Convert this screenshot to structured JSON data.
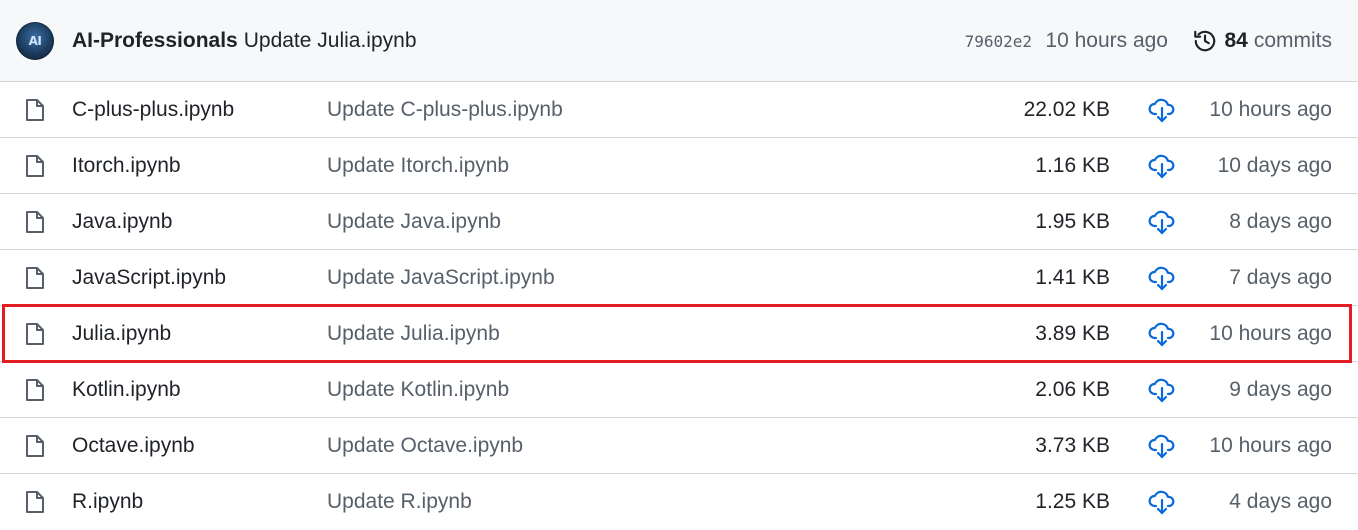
{
  "header": {
    "avatar_text": "AI",
    "author": "AI-Professionals",
    "message": "Update Julia.ipynb",
    "hash": "79602e2",
    "time": "10 hours ago",
    "commit_count": "84",
    "commit_label": "commits"
  },
  "files": [
    {
      "name": "C-plus-plus.ipynb",
      "message": "Update C-plus-plus.ipynb",
      "size": "22.02 KB",
      "time": "10 hours ago",
      "highlighted": false
    },
    {
      "name": "Itorch.ipynb",
      "message": "Update Itorch.ipynb",
      "size": "1.16 KB",
      "time": "10 days ago",
      "highlighted": false
    },
    {
      "name": "Java.ipynb",
      "message": "Update Java.ipynb",
      "size": "1.95 KB",
      "time": "8 days ago",
      "highlighted": false
    },
    {
      "name": "JavaScript.ipynb",
      "message": "Update JavaScript.ipynb",
      "size": "1.41 KB",
      "time": "7 days ago",
      "highlighted": false
    },
    {
      "name": "Julia.ipynb",
      "message": "Update Julia.ipynb",
      "size": "3.89 KB",
      "time": "10 hours ago",
      "highlighted": true
    },
    {
      "name": "Kotlin.ipynb",
      "message": "Update Kotlin.ipynb",
      "size": "2.06 KB",
      "time": "9 days ago",
      "highlighted": false
    },
    {
      "name": "Octave.ipynb",
      "message": "Update Octave.ipynb",
      "size": "3.73 KB",
      "time": "10 hours ago",
      "highlighted": false
    },
    {
      "name": "R.ipynb",
      "message": "Update R.ipynb",
      "size": "1.25 KB",
      "time": "4 days ago",
      "highlighted": false
    }
  ],
  "icons": {
    "file": "file-icon",
    "download": "download-cloud-icon",
    "history": "history-icon"
  },
  "colors": {
    "download_icon": "#0969da",
    "highlight_border": "#e31c23",
    "header_bg": "#f6f8fa",
    "muted_text": "#57606a"
  }
}
